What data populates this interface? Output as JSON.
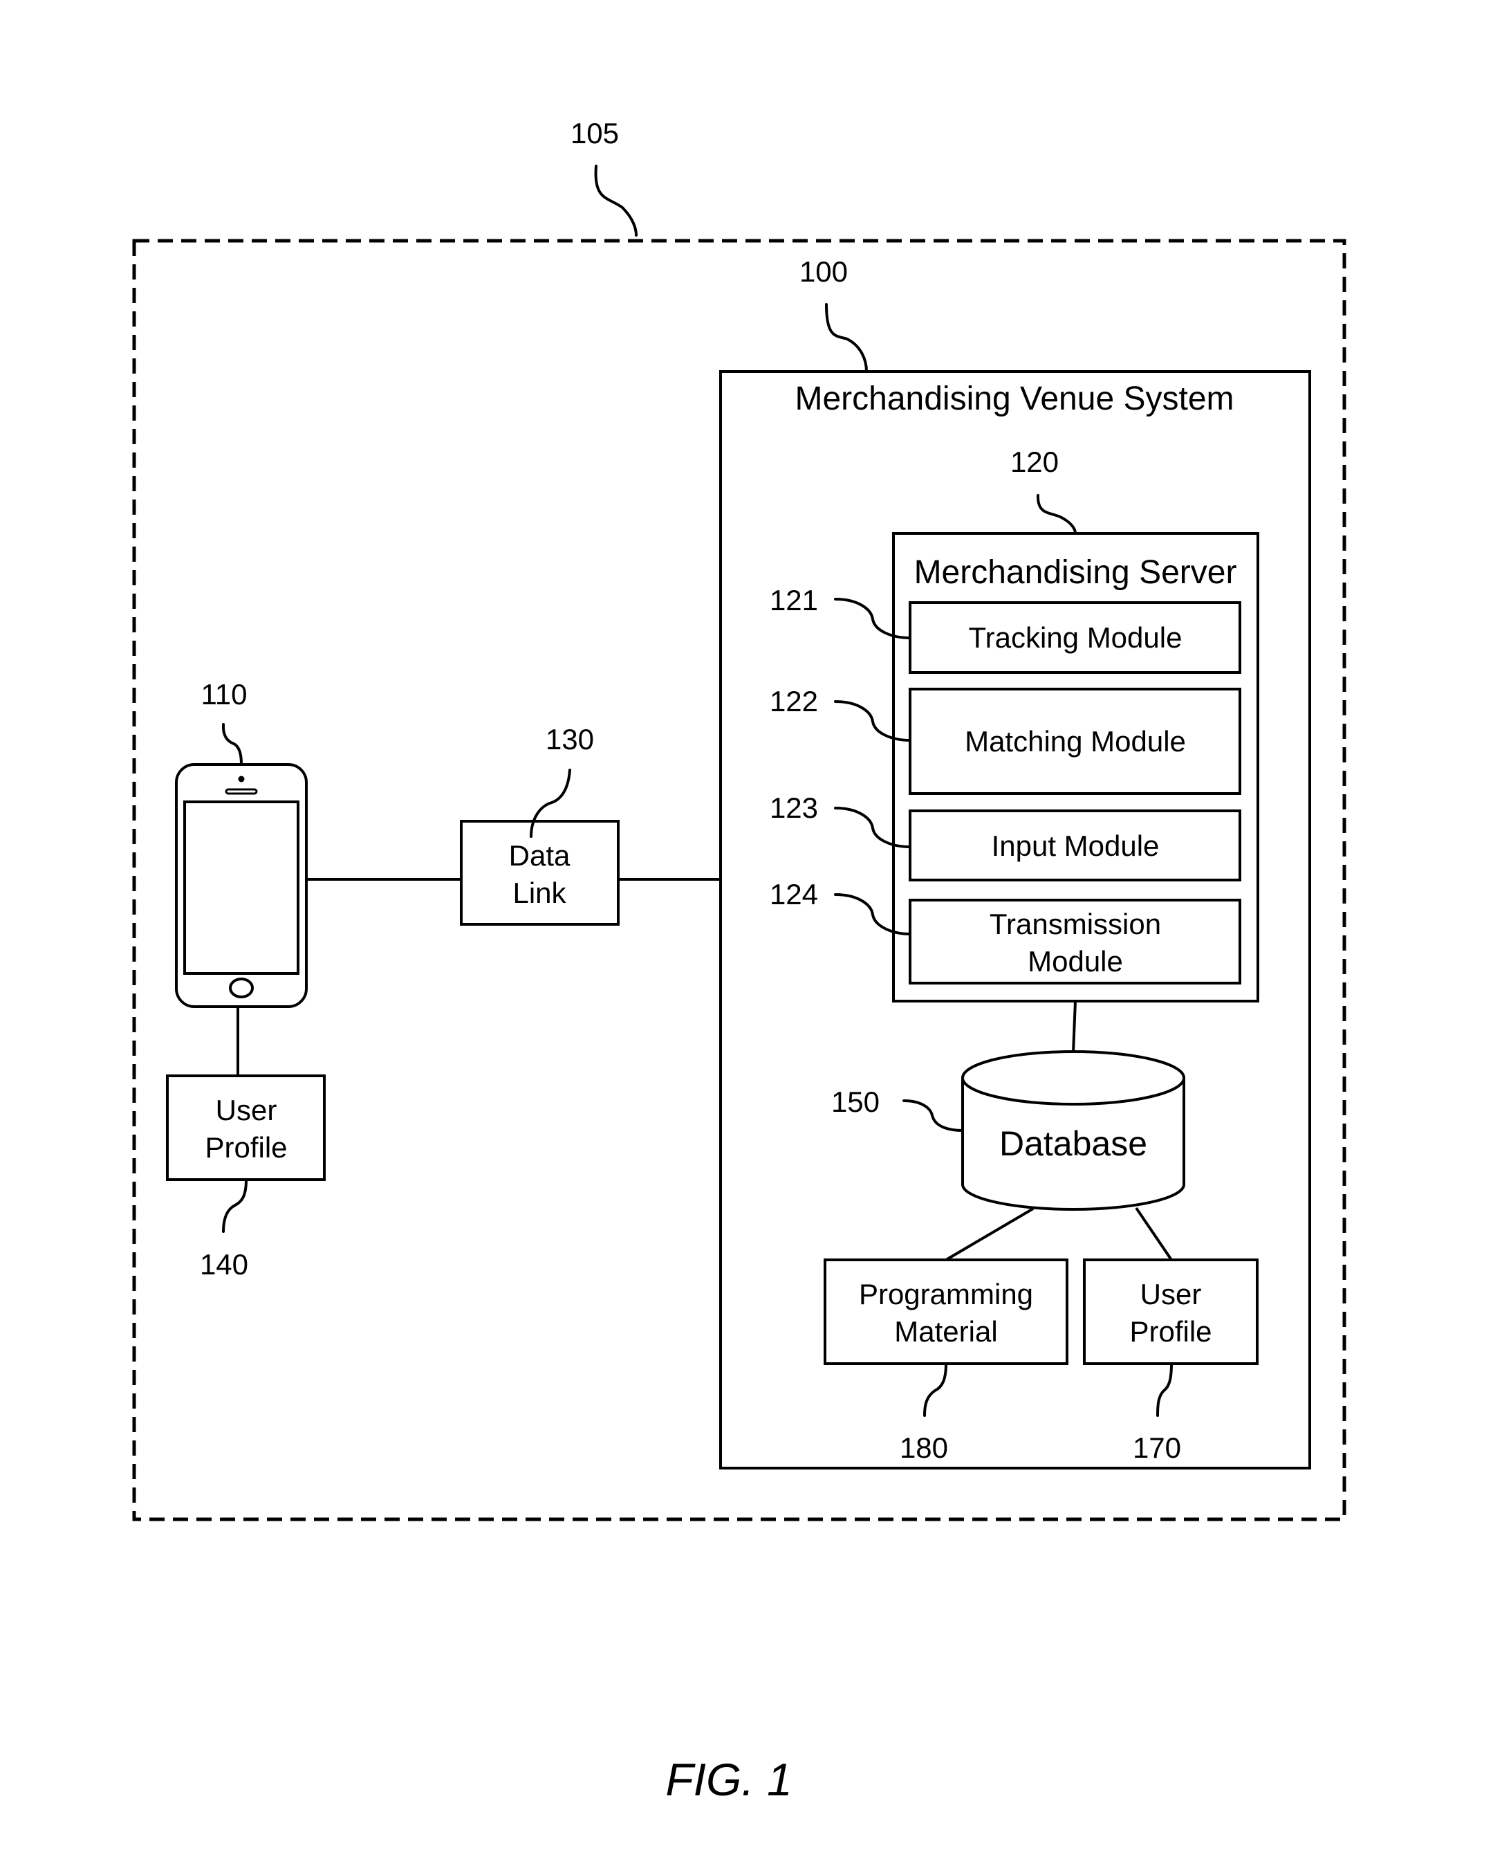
{
  "figure": {
    "caption": "FIG. 1",
    "environment": {
      "ref": "105"
    },
    "system": {
      "ref": "100",
      "title": "Merchandising Venue System"
    },
    "server": {
      "ref": "120",
      "title": "Merchandising Server",
      "modules": [
        {
          "ref": "121",
          "label": "Tracking Module"
        },
        {
          "ref": "122",
          "label": "Matching Module"
        },
        {
          "ref": "123",
          "label": "Input Module"
        },
        {
          "ref": "124",
          "label_line1": "Transmission",
          "label_line2": "Module"
        }
      ]
    },
    "database": {
      "ref": "150",
      "label": "Database"
    },
    "programming_material": {
      "ref": "180",
      "line1": "Programming",
      "line2": "Material"
    },
    "server_user_profile": {
      "ref": "170",
      "line1": "User",
      "line2": "Profile"
    },
    "mobile_device": {
      "ref": "110",
      "icon": "smartphone-icon"
    },
    "device_user_profile": {
      "ref": "140",
      "line1": "User",
      "line2": "Profile"
    },
    "data_link": {
      "ref": "130",
      "line1": "Data",
      "line2": "Link"
    }
  }
}
